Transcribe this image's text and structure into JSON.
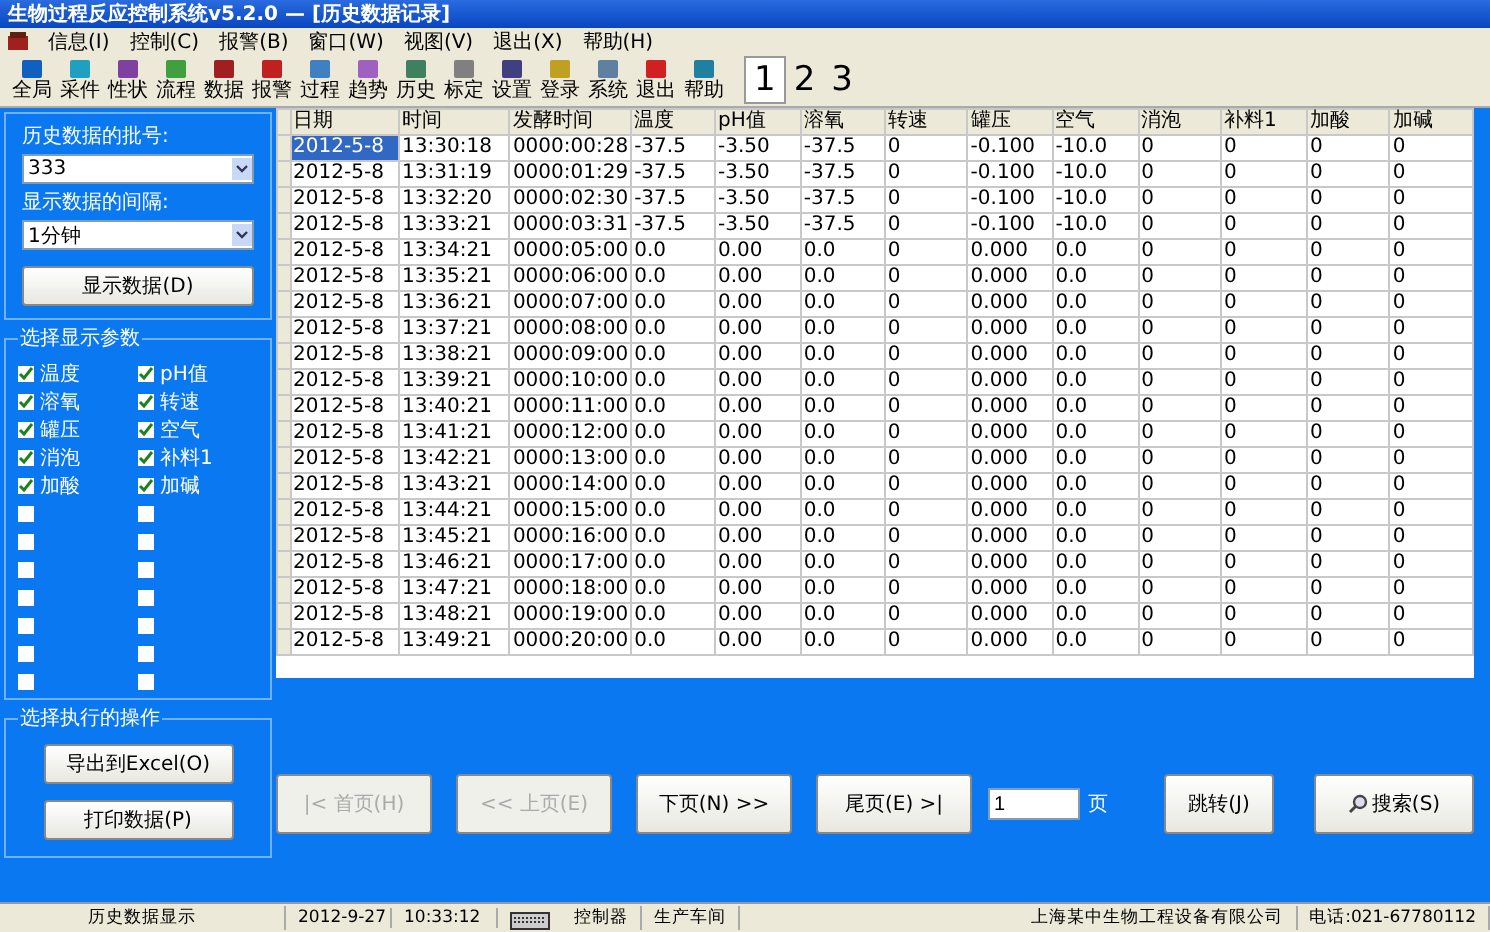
{
  "window": {
    "title": "生物过程反应控制系统v5.2.0 — [历史数据记录]"
  },
  "menu": [
    "信息(I)",
    "控制(C)",
    "报警(B)",
    "窗口(W)",
    "视图(V)",
    "退出(X)",
    "帮助(H)"
  ],
  "toolbar": [
    {
      "label": "全局",
      "color": "#1060c0"
    },
    {
      "label": "采件",
      "color": "#20a0c0"
    },
    {
      "label": "性状",
      "color": "#8040a0"
    },
    {
      "label": "流程",
      "color": "#40a040"
    },
    {
      "label": "数据",
      "color": "#a02020"
    },
    {
      "label": "报警",
      "color": "#c02020"
    },
    {
      "label": "过程",
      "color": "#4080c0"
    },
    {
      "label": "趋势",
      "color": "#a060c0"
    },
    {
      "label": "历史",
      "color": "#408060"
    },
    {
      "label": "标定",
      "color": "#808080"
    },
    {
      "label": "设置",
      "color": "#404080"
    },
    {
      "label": "登录",
      "color": "#c0a020"
    },
    {
      "label": "系统",
      "color": "#6080a0"
    },
    {
      "label": "退出",
      "color": "#d02020"
    },
    {
      "label": "帮助",
      "color": "#2080a0"
    }
  ],
  "pages": [
    {
      "label": "1",
      "selected": true
    },
    {
      "label": "2",
      "selected": false
    },
    {
      "label": "3",
      "selected": false
    }
  ],
  "sidebar": {
    "batch_label": "历史数据的批号:",
    "batch_value": "333",
    "interval_label": "显示数据的间隔:",
    "interval_value": "1分钟",
    "show_button": "显示数据(D)",
    "params_title": "选择显示参数",
    "params": [
      {
        "label": "温度",
        "checked": true
      },
      {
        "label": "pH值",
        "checked": true
      },
      {
        "label": "溶氧",
        "checked": true
      },
      {
        "label": "转速",
        "checked": true
      },
      {
        "label": "罐压",
        "checked": true
      },
      {
        "label": "空气",
        "checked": true
      },
      {
        "label": "消泡",
        "checked": true
      },
      {
        "label": "补料1",
        "checked": true
      },
      {
        "label": "加酸",
        "checked": true
      },
      {
        "label": "加碱",
        "checked": true
      },
      {
        "checked": false
      },
      {
        "checked": false
      },
      {
        "checked": false
      },
      {
        "checked": false
      },
      {
        "checked": false
      },
      {
        "checked": false
      },
      {
        "checked": false
      },
      {
        "checked": false
      },
      {
        "checked": false
      },
      {
        "checked": false
      },
      {
        "checked": false
      },
      {
        "checked": false
      },
      {
        "checked": false
      },
      {
        "checked": false
      }
    ],
    "ops_title": "选择执行的操作",
    "ops_buttons": [
      "导出到Excel(O)",
      "打印数据(P)"
    ]
  },
  "table": {
    "columns": [
      "日期",
      "时间",
      "发酵时间",
      "温度",
      "pH值",
      "溶氧",
      "转速",
      "罐压",
      "空气",
      "消泡",
      "补料1",
      "加酸",
      "加碱"
    ],
    "rows": [
      {
        "selected": true,
        "cells": [
          "2012-5-8",
          "13:30:18",
          "0000:00:28",
          "-37.5",
          "-3.50",
          "-37.5",
          "0",
          "-0.100",
          "-10.0",
          "0",
          "0",
          "0",
          "0"
        ]
      },
      {
        "selected": false,
        "cells": [
          "2012-5-8",
          "13:31:19",
          "0000:01:29",
          "-37.5",
          "-3.50",
          "-37.5",
          "0",
          "-0.100",
          "-10.0",
          "0",
          "0",
          "0",
          "0"
        ]
      },
      {
        "selected": false,
        "cells": [
          "2012-5-8",
          "13:32:20",
          "0000:02:30",
          "-37.5",
          "-3.50",
          "-37.5",
          "0",
          "-0.100",
          "-10.0",
          "0",
          "0",
          "0",
          "0"
        ]
      },
      {
        "selected": false,
        "cells": [
          "2012-5-8",
          "13:33:21",
          "0000:03:31",
          "-37.5",
          "-3.50",
          "-37.5",
          "0",
          "-0.100",
          "-10.0",
          "0",
          "0",
          "0",
          "0"
        ]
      },
      {
        "selected": false,
        "cells": [
          "2012-5-8",
          "13:34:21",
          "0000:05:00",
          "0.0",
          "0.00",
          "0.0",
          "0",
          "0.000",
          "0.0",
          "0",
          "0",
          "0",
          "0"
        ]
      },
      {
        "selected": false,
        "cells": [
          "2012-5-8",
          "13:35:21",
          "0000:06:00",
          "0.0",
          "0.00",
          "0.0",
          "0",
          "0.000",
          "0.0",
          "0",
          "0",
          "0",
          "0"
        ]
      },
      {
        "selected": false,
        "cells": [
          "2012-5-8",
          "13:36:21",
          "0000:07:00",
          "0.0",
          "0.00",
          "0.0",
          "0",
          "0.000",
          "0.0",
          "0",
          "0",
          "0",
          "0"
        ]
      },
      {
        "selected": false,
        "cells": [
          "2012-5-8",
          "13:37:21",
          "0000:08:00",
          "0.0",
          "0.00",
          "0.0",
          "0",
          "0.000",
          "0.0",
          "0",
          "0",
          "0",
          "0"
        ]
      },
      {
        "selected": false,
        "cells": [
          "2012-5-8",
          "13:38:21",
          "0000:09:00",
          "0.0",
          "0.00",
          "0.0",
          "0",
          "0.000",
          "0.0",
          "0",
          "0",
          "0",
          "0"
        ]
      },
      {
        "selected": false,
        "cells": [
          "2012-5-8",
          "13:39:21",
          "0000:10:00",
          "0.0",
          "0.00",
          "0.0",
          "0",
          "0.000",
          "0.0",
          "0",
          "0",
          "0",
          "0"
        ]
      },
      {
        "selected": false,
        "cells": [
          "2012-5-8",
          "13:40:21",
          "0000:11:00",
          "0.0",
          "0.00",
          "0.0",
          "0",
          "0.000",
          "0.0",
          "0",
          "0",
          "0",
          "0"
        ]
      },
      {
        "selected": false,
        "cells": [
          "2012-5-8",
          "13:41:21",
          "0000:12:00",
          "0.0",
          "0.00",
          "0.0",
          "0",
          "0.000",
          "0.0",
          "0",
          "0",
          "0",
          "0"
        ]
      },
      {
        "selected": false,
        "cells": [
          "2012-5-8",
          "13:42:21",
          "0000:13:00",
          "0.0",
          "0.00",
          "0.0",
          "0",
          "0.000",
          "0.0",
          "0",
          "0",
          "0",
          "0"
        ]
      },
      {
        "selected": false,
        "cells": [
          "2012-5-8",
          "13:43:21",
          "0000:14:00",
          "0.0",
          "0.00",
          "0.0",
          "0",
          "0.000",
          "0.0",
          "0",
          "0",
          "0",
          "0"
        ]
      },
      {
        "selected": false,
        "cells": [
          "2012-5-8",
          "13:44:21",
          "0000:15:00",
          "0.0",
          "0.00",
          "0.0",
          "0",
          "0.000",
          "0.0",
          "0",
          "0",
          "0",
          "0"
        ]
      },
      {
        "selected": false,
        "cells": [
          "2012-5-8",
          "13:45:21",
          "0000:16:00",
          "0.0",
          "0.00",
          "0.0",
          "0",
          "0.000",
          "0.0",
          "0",
          "0",
          "0",
          "0"
        ]
      },
      {
        "selected": false,
        "cells": [
          "2012-5-8",
          "13:46:21",
          "0000:17:00",
          "0.0",
          "0.00",
          "0.0",
          "0",
          "0.000",
          "0.0",
          "0",
          "0",
          "0",
          "0"
        ]
      },
      {
        "selected": false,
        "cells": [
          "2012-5-8",
          "13:47:21",
          "0000:18:00",
          "0.0",
          "0.00",
          "0.0",
          "0",
          "0.000",
          "0.0",
          "0",
          "0",
          "0",
          "0"
        ]
      },
      {
        "selected": false,
        "cells": [
          "2012-5-8",
          "13:48:21",
          "0000:19:00",
          "0.0",
          "0.00",
          "0.0",
          "0",
          "0.000",
          "0.0",
          "0",
          "0",
          "0",
          "0"
        ]
      },
      {
        "selected": false,
        "cells": [
          "2012-5-8",
          "13:49:21",
          "0000:20:00",
          "0.0",
          "0.00",
          "0.0",
          "0",
          "0.000",
          "0.0",
          "0",
          "0",
          "0",
          "0"
        ]
      }
    ]
  },
  "pager": {
    "buttons": [
      {
        "label": "|<  首页(H)",
        "disabled": true
      },
      {
        "label": "<<  上页(E)",
        "disabled": true
      },
      {
        "label": "下页(N)  >>",
        "disabled": false
      },
      {
        "label": "尾页(E)  >|",
        "disabled": false
      }
    ],
    "page_value": "1",
    "page_unit": "页",
    "jump_button": "跳转(J)",
    "search_button": "搜索(S)"
  },
  "status_bar": {
    "mode": "历史数据显示",
    "date": "2012-9-27",
    "time": "10:33:12",
    "controller": "控制器",
    "workshop": "生产车间",
    "company": "上海某中生物工程设备有限公司",
    "phone": "电话:021-67780112"
  }
}
